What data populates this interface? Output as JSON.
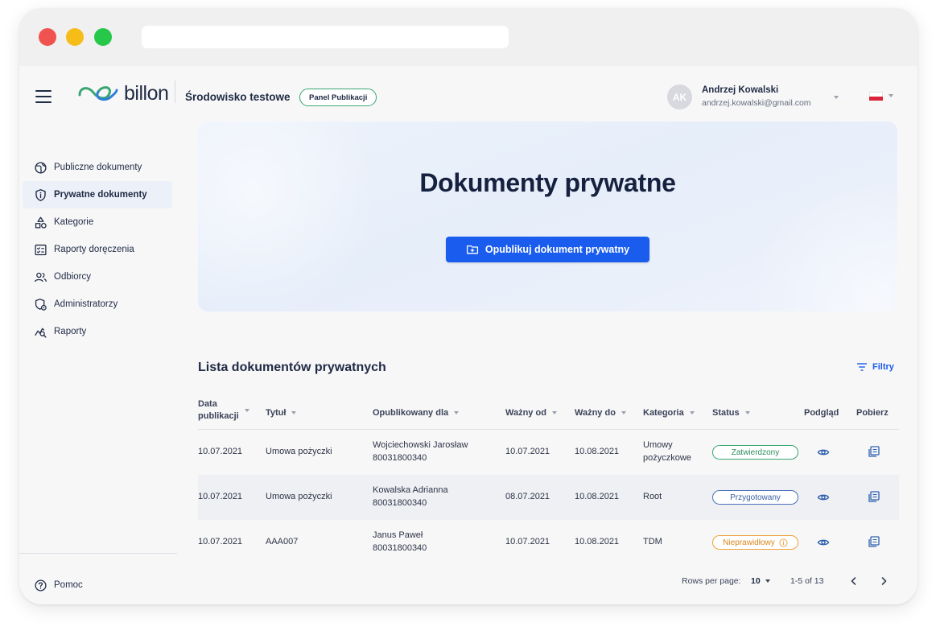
{
  "header": {
    "logo_text": "billon",
    "environment": "Środowisko testowe",
    "panel_badge": "Panel Publikacji",
    "user": {
      "initials": "AK",
      "name": "Andrzej Kowalski",
      "email": "andrzej.kowalski@gmail.com"
    },
    "language_icon": "poland-flag-icon"
  },
  "sidebar": {
    "items": [
      {
        "label": "Publiczne dokumenty",
        "icon": "globe-icon",
        "active": false
      },
      {
        "label": "Prywatne dokumenty",
        "icon": "shield-info-icon",
        "active": true
      },
      {
        "label": "Kategorie",
        "icon": "shapes-icon",
        "active": false
      },
      {
        "label": "Raporty doręczenia",
        "icon": "report-checklist-icon",
        "active": false
      },
      {
        "label": "Odbiorcy",
        "icon": "users-icon",
        "active": false
      },
      {
        "label": "Administratorzy",
        "icon": "admin-shield-icon",
        "active": false
      },
      {
        "label": "Raporty",
        "icon": "analytics-icon",
        "active": false
      }
    ],
    "help_label": "Pomoc"
  },
  "hero": {
    "title": "Dokumenty prywatne",
    "publish_button": "Opublikuj dokument prywatny"
  },
  "list": {
    "title": "Lista dokumentów prywatnych",
    "filters_label": "Filtry",
    "columns": {
      "date_line1": "Data",
      "date_line2": "publikacji",
      "title": "Tytuł",
      "published_for": "Opublikowany dla",
      "valid_from": "Ważny od",
      "valid_to": "Ważny do",
      "category": "Kategoria",
      "status": "Status",
      "preview": "Podgląd",
      "download": "Pobierz"
    },
    "rows": [
      {
        "date": "10.07.2021",
        "title": "Umowa pożyczki",
        "recipient_name": "Wojciechowski Jarosław",
        "recipient_id": "80031800340",
        "valid_from": "10.07.2021",
        "valid_to": "10.08.2021",
        "category_line1": "Umowy",
        "category_line2": "pożyczkowe",
        "status": "Zatwierdzony",
        "status_color": "#3aa672"
      },
      {
        "date": "10.07.2021",
        "title": "Umowa pożyczki",
        "recipient_name": "Kowalska Adrianna",
        "recipient_id": "80031800340",
        "valid_from": "08.07.2021",
        "valid_to": "10.08.2021",
        "category_line1": "Root",
        "category_line2": "",
        "status": "Przygotowany",
        "status_color": "#4a6fb8"
      },
      {
        "date": "10.07.2021",
        "title": "AAA007",
        "recipient_name": "Janus Paweł",
        "recipient_id": "80031800340",
        "valid_from": "10.07.2021",
        "valid_to": "10.08.2021",
        "category_line1": "TDM",
        "category_line2": "",
        "status": "Nieprawidłowy",
        "status_color": "#eea13a"
      }
    ]
  },
  "pagination": {
    "rows_per_page_label": "Rows per page:",
    "rows_per_page_value": "10",
    "range": "1-5 of 13"
  },
  "colors": {
    "accent": "#1a5cee",
    "text": "#1f2a44",
    "logo_green": "#3aa672",
    "logo_blue": "#2f7fd6"
  }
}
